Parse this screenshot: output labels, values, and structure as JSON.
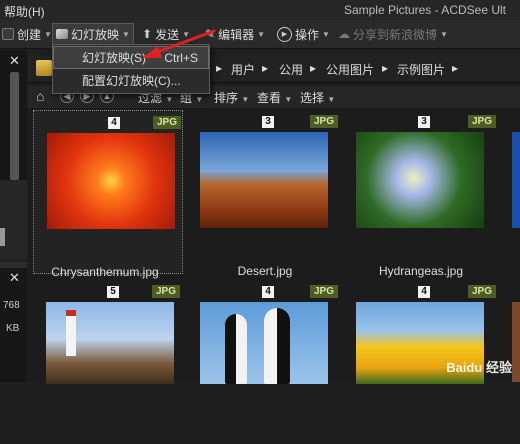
{
  "menubar": {
    "help": "帮助(H)",
    "window_title": "Sample Pictures - ACDSee Ult"
  },
  "toolbar": {
    "create": "创建",
    "slideshow": "幻灯放映",
    "send": "发送",
    "editor": "编辑器",
    "actions": "操作",
    "share": "分享到新浪微博"
  },
  "dropdown": {
    "items": [
      {
        "label": "幻灯放映(S)",
        "shortcut": "Ctrl+S"
      },
      {
        "label": "配置幻灯放映(C)..."
      }
    ]
  },
  "breadcrumb": {
    "items": [
      "用户",
      "公用",
      "公用图片",
      "示例图片"
    ]
  },
  "filterbar": {
    "filter": "过滤",
    "group": "组",
    "sort": "排序",
    "view": "查看",
    "select": "选择"
  },
  "left_panel": {
    "size1": "768",
    "size2": "KB"
  },
  "thumbnails": [
    {
      "name": "Chrysanthemum.jpg",
      "rating": "4",
      "type": "JPG"
    },
    {
      "name": "Desert.jpg",
      "rating": "3",
      "type": "JPG"
    },
    {
      "name": "Hydrangeas.jpg",
      "rating": "3",
      "type": "JPG"
    },
    {
      "name": "",
      "rating": "5",
      "type": "JPG"
    },
    {
      "name": "",
      "rating": "4",
      "type": "JPG"
    },
    {
      "name": "",
      "rating": "4",
      "type": "JPG"
    }
  ],
  "watermark": "Baidu 经验",
  "colors": {
    "background": "#1f1f1f",
    "badge_type": "#4d5d24",
    "arrow": "#e0201e"
  }
}
